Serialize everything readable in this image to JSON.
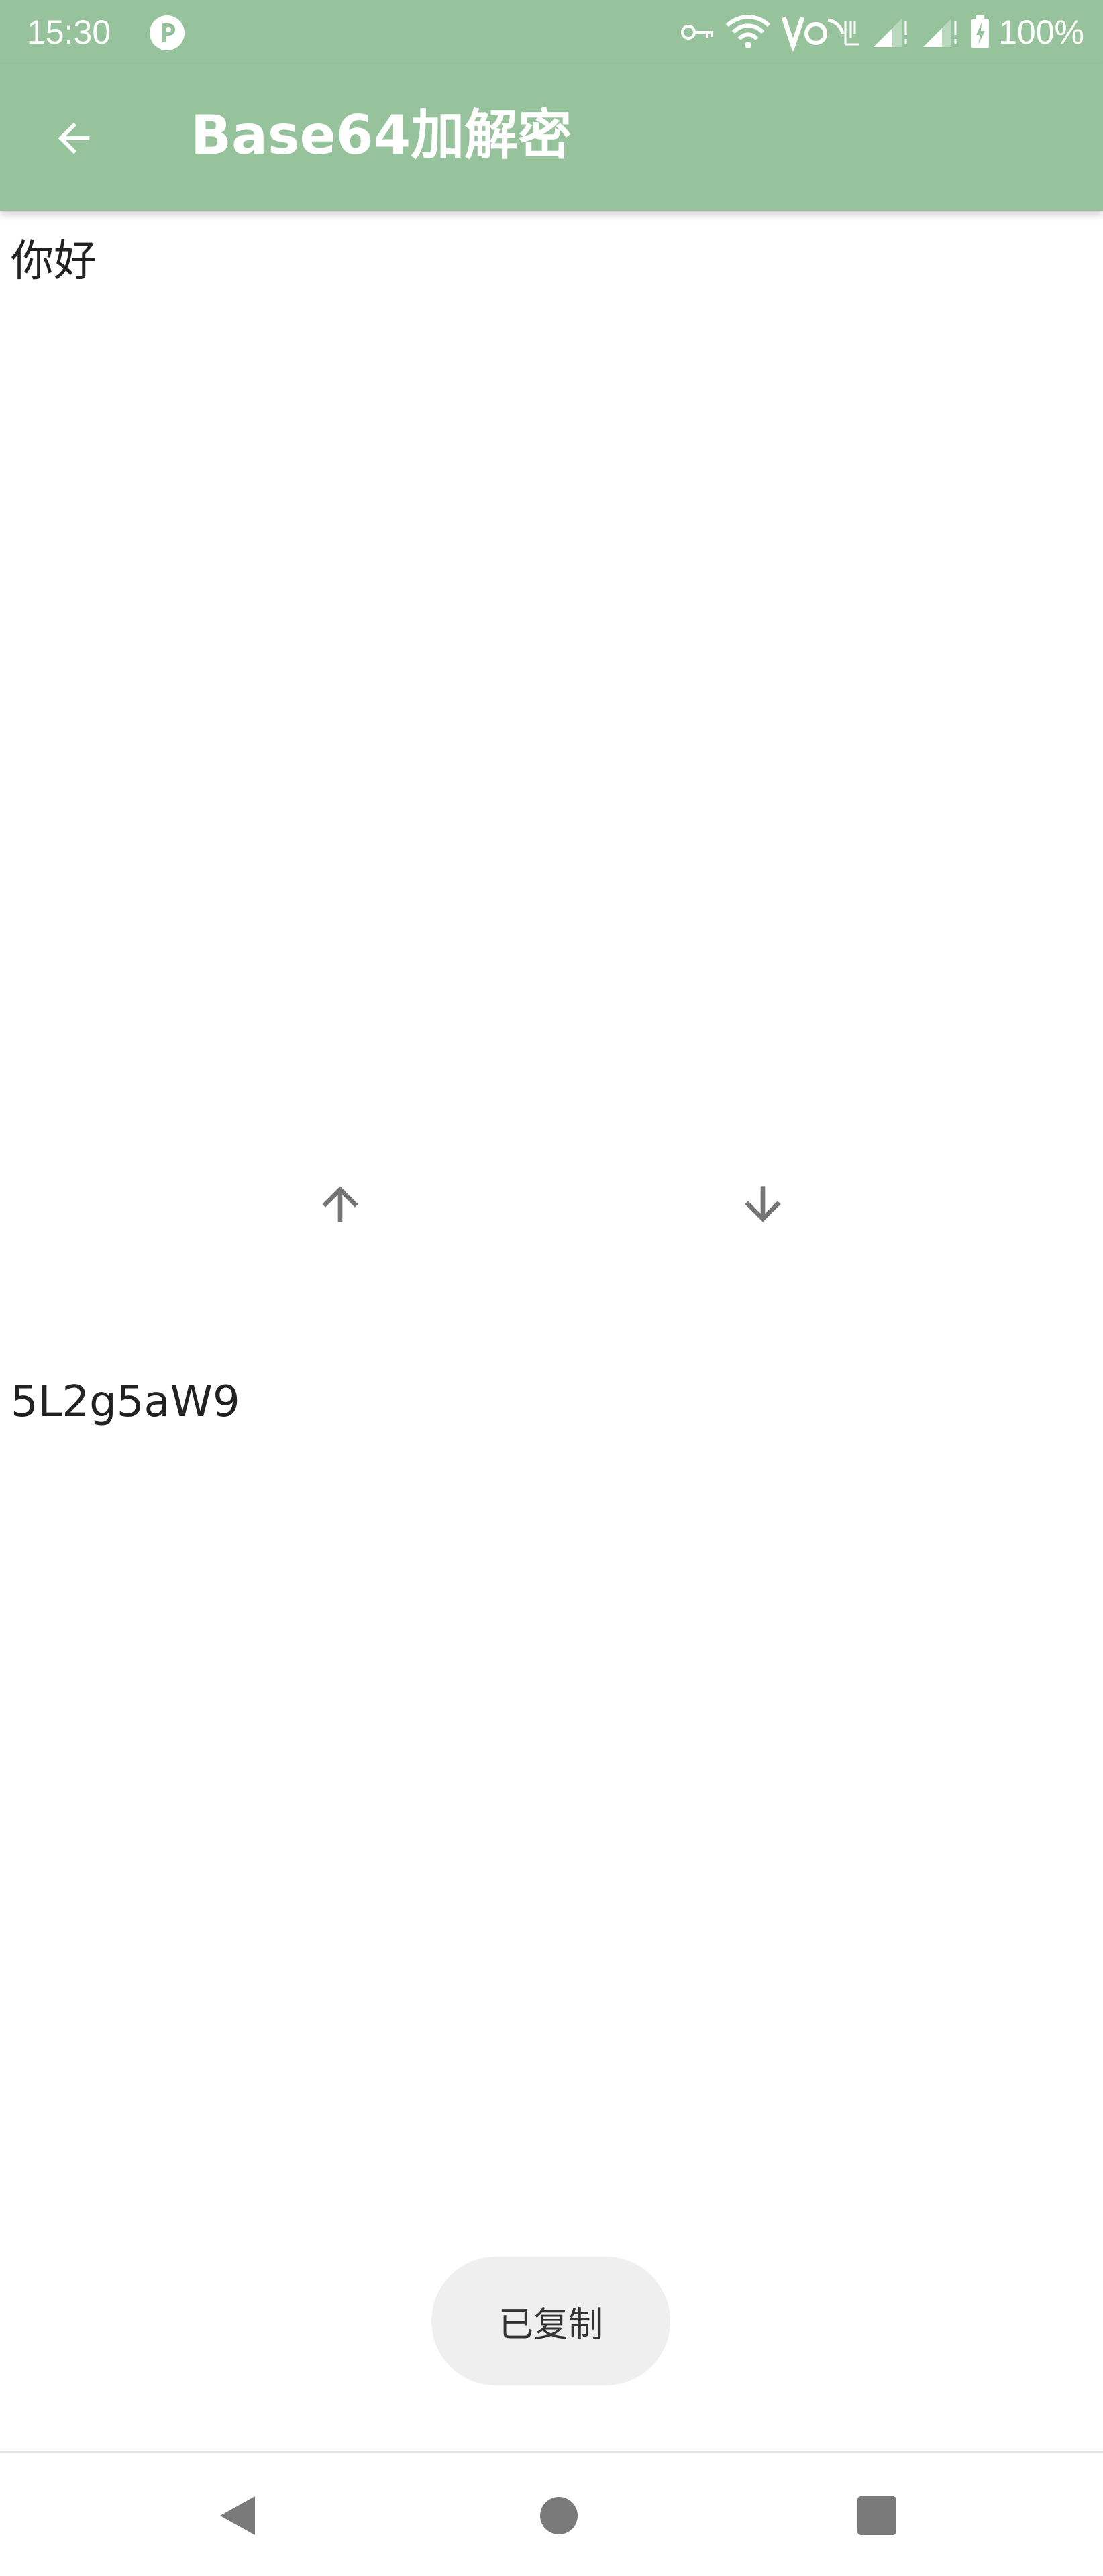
{
  "status_bar": {
    "time": "15:30",
    "battery": "100%",
    "icons": [
      "app-notification-icon",
      "vpn-key-icon",
      "wifi-icon",
      "volte-icon",
      "signal-icon",
      "signal-icon",
      "battery-charging-icon"
    ]
  },
  "app_bar": {
    "title": "Base64加解密",
    "back_icon": "arrow-back-icon",
    "background": "#96c39b"
  },
  "input": {
    "value": "你好"
  },
  "controls": {
    "encode_icon": "arrow-up-icon",
    "decode_icon": "arrow-down-icon"
  },
  "output": {
    "value": "5L2g5aW9"
  },
  "toast": {
    "message": "已复制"
  },
  "nav_bar": {
    "icons": [
      "back-triangle-icon",
      "home-circle-icon",
      "recents-square-icon"
    ]
  }
}
